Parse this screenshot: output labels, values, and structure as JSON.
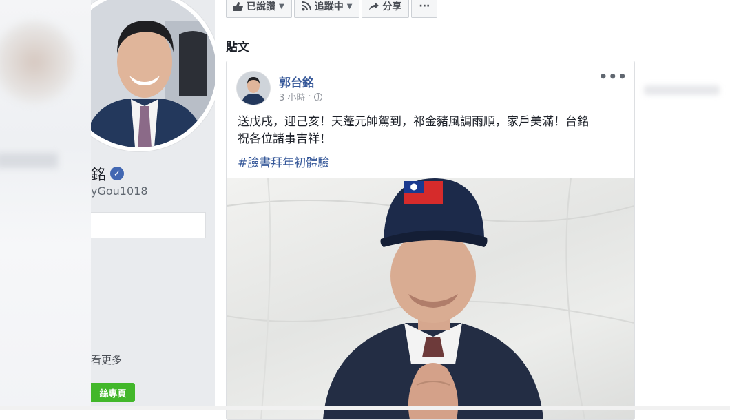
{
  "profile": {
    "name_partial": "銘",
    "handle_partial": "yGou1018",
    "see_more_partial": "看更多",
    "like_button_partial": "絲專頁"
  },
  "actions": [
    {
      "label": "已說讚",
      "icon": "thumbs-up-icon",
      "has_caret": true
    },
    {
      "label": "追蹤中",
      "icon": "rss-feed-icon",
      "has_caret": true
    },
    {
      "label": "分享",
      "icon": "share-arrow-icon",
      "has_caret": false
    },
    {
      "label": "···",
      "icon": "more-dots-icon",
      "has_caret": false
    }
  ],
  "section": {
    "title": "貼文"
  },
  "post": {
    "author": "郭台銘",
    "time": "3 小時",
    "separator": "·",
    "privacy_icon": "globe-icon",
    "more_label": "•••",
    "text_line1": "送戊戌，迎己亥！天蓬元帥駕到，祁金豬風調雨順，家戶美滿！台銘",
    "text_line2": "祝各位諸事吉祥！",
    "hashtag": "#臉書拜年初體驗"
  },
  "colors": {
    "fb_blue": "#365899",
    "verified_blue": "#4267b2",
    "green_button": "#42b72a",
    "page_bg": "#e9ebee",
    "hat_navy": "#1c2a4a",
    "flag_red": "#d62b2b"
  }
}
